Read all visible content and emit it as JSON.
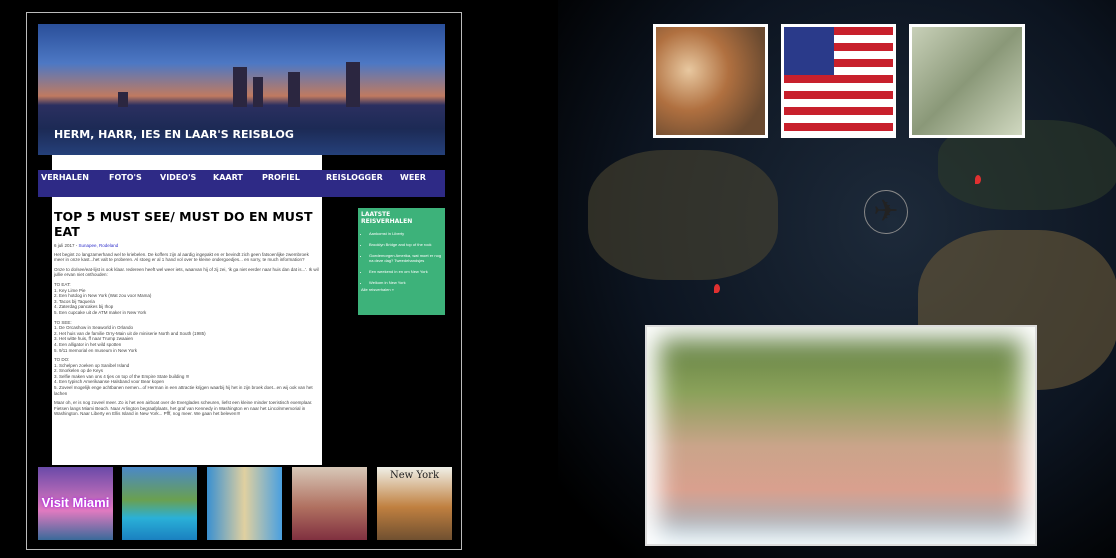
{
  "blog": {
    "title": "HERM, HARR, IES EN LAAR'S REISBLOG",
    "nav": [
      "VERHALEN",
      "FOTO'S",
      "VIDEO'S",
      "KAART",
      "PROFIEL",
      "REISLOGGER",
      "WEER"
    ],
    "post": {
      "title": "TOP 5 MUST SEE/ MUST DO EN MUST EAT",
      "date": "6 juli 2017 - ",
      "location": "Sunapee, Rodeland",
      "intro": "Het begint zo langzamerhand wel te kriebelen. De koffers zijn al aardig ingepakt en er bevindt zich geen fatsoenlijke zwembroek meer in onze kast...het valt te proberen. Al stoeg er al 1 hand vol over te kleine ondergoedjes... en sorry, te much information?",
      "intro2": "Onze to do/see/eat-lijst is ook klaar. Iedereen heeft wel weer iets, waarvan hij of zij zei, 'ik ga niet eerder naar huis dan dat is...'. Ik wil jullie ervan niet onthouden:",
      "eat_head": "TO EAT:",
      "eat": [
        "1. Key Lime Pie",
        "2. Een hotdog in New York (Wat zou voor Mama)",
        "3. Tacos bij Taqueria",
        "4. Zaterdag pancakes bij Ihop",
        "5. Een cupcake uit de ATM maker in New York"
      ],
      "see_head": "TO SEE:",
      "see": [
        "1. De Orcashow in Seaworld in Orlando",
        "2. Het huis van de familie Orry-Main uit de miniserie North and South (1985)",
        "3. Het witte huis, ff naar Trump zwaaien",
        "4. Een alligator in het wild spotten",
        "5. 9/11 memorial en museum in New York"
      ],
      "do_head": "TO DO:",
      "do": [
        "1. Schelpen zoeken op Sanibel Island",
        "2. Snorkelen op de Keys",
        "3. Selfie maken van ons 4 tjes on top of the Empire State building !!!",
        "4. Een typisch Amerikaanse Halsband voor Bear kopen",
        "5. Zoveel mogelijk enge achtbanen nemen...of Herman in een attractie krijgen waarbij hij het in zijn broek doet...en wij ook van het lachen"
      ],
      "outro": "Maar oh, er is nog zoveel meer. Zo is het een airboat over de Everglades scheuren, liefst een kleine minder toeristisch exemplaar. Fietsen langs Miami Beach. Naar Arlington begraafplaats, het graf van Kennedy in Washington en naar het Lincolnmemorial in Washington. Naar Liberty en Ellis Island in New York... Pfff, nog meer. We gaan het beleven!!!"
    },
    "sidebar": {
      "title": "LAATSTE REISVERHALEN",
      "items": [
        "Aankomst in Liberty",
        "Brooklyn Bridge and top of the rock",
        "Goedemorgen Amerika, wat moet er nog na deze dag? Tweedehandsjes",
        "Een weekend in en om New York",
        "Welkom in New York"
      ],
      "more": "Alle reisverhalen »"
    },
    "thumbnails": [
      "Visit Miami",
      "Resort pool",
      "Orlando parade",
      "Hotel room",
      "New York"
    ]
  },
  "map": {
    "pins": 2
  },
  "colors": {
    "nav": "#2e2a86",
    "sidebar": "#3db27a"
  }
}
